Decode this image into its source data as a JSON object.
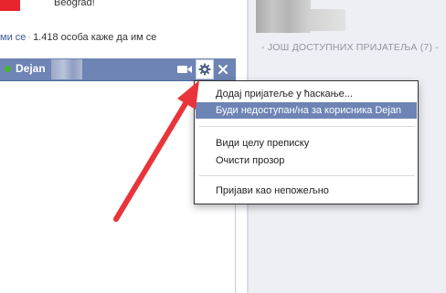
{
  "feed": {
    "location_text": "Beograd!",
    "like_link": "ми се",
    "like_count_text": "1.418 особа каже да им се"
  },
  "chat": {
    "name": "Dejan",
    "icons": {
      "status": "online-dot-icon",
      "video": "video-icon",
      "options": "gear-icon",
      "close": "close-icon"
    }
  },
  "sidebar": {
    "section_title": "ЈОШ ДОСТУПНИХ ПРИЈАТЕЉА (7)"
  },
  "menu": {
    "items": [
      {
        "label": "Додај пријатеље у ћаскање..."
      },
      {
        "label": "Буди недоступан/на за корисника Dejan"
      },
      {
        "label": "Види целу преписку"
      },
      {
        "label": "Очисти прозор"
      },
      {
        "label": "Пријави као непожељно"
      }
    ],
    "selected_index": 1
  },
  "colors": {
    "chat_header": "#6d84b4",
    "menu_highlight": "#6d84b4",
    "arrow": "#e8343a",
    "link": "#3b5998",
    "online": "#42b72a"
  }
}
